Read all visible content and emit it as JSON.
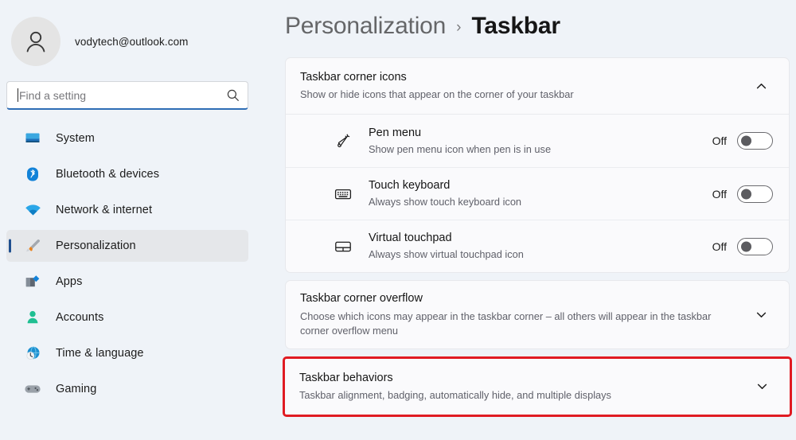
{
  "sidebar": {
    "account": {
      "email": "vodytech@outlook.com",
      "avatar_icon": "person-avatar-icon"
    },
    "search": {
      "placeholder": "Find a setting",
      "value": "",
      "icon": "search-icon"
    },
    "items": [
      {
        "label": "System",
        "icon": "monitor-icon",
        "selected": false
      },
      {
        "label": "Bluetooth & devices",
        "icon": "bluetooth-icon",
        "selected": false
      },
      {
        "label": "Network & internet",
        "icon": "wifi-icon",
        "selected": false
      },
      {
        "label": "Personalization",
        "icon": "paintbrush-icon",
        "selected": true
      },
      {
        "label": "Apps",
        "icon": "apps-icon",
        "selected": false
      },
      {
        "label": "Accounts",
        "icon": "account-icon",
        "selected": false
      },
      {
        "label": "Time & language",
        "icon": "clock-globe-icon",
        "selected": false
      },
      {
        "label": "Gaming",
        "icon": "gamepad-icon",
        "selected": false
      }
    ]
  },
  "header": {
    "breadcrumb_parent": "Personalization",
    "breadcrumb_separator": "›",
    "breadcrumb_current": "Taskbar"
  },
  "main": {
    "cards": [
      {
        "title": "Taskbar corner icons",
        "subtitle": "Show or hide icons that appear on the corner of your taskbar",
        "chevron": "chevron-up-icon",
        "expanded": true,
        "highlighted": false,
        "rows": [
          {
            "title": "Pen menu",
            "subtitle": "Show pen menu icon when pen is in use",
            "icon": "pen-icon",
            "toggle_label": "Off",
            "toggle_state": "off"
          },
          {
            "title": "Touch keyboard",
            "subtitle": "Always show touch keyboard icon",
            "icon": "touch-keyboard-icon",
            "toggle_label": "Off",
            "toggle_state": "off"
          },
          {
            "title": "Virtual touchpad",
            "subtitle": "Always show virtual touchpad icon",
            "icon": "touchpad-icon",
            "toggle_label": "Off",
            "toggle_state": "off"
          }
        ]
      },
      {
        "title": "Taskbar corner overflow",
        "subtitle": "Choose which icons may appear in the taskbar corner – all others will appear in the taskbar corner overflow menu",
        "chevron": "chevron-down-icon",
        "expanded": false,
        "highlighted": false,
        "rows": []
      },
      {
        "title": "Taskbar behaviors",
        "subtitle": "Taskbar alignment, badging, automatically hide, and multiple displays",
        "chevron": "chevron-down-icon",
        "expanded": false,
        "highlighted": true,
        "rows": []
      }
    ]
  },
  "colors": {
    "page_background": "#eff3f8",
    "card_background": "#fafafc",
    "accent": "#1f4f8f",
    "highlight_border": "#e01b22",
    "search_focus_underline": "#2f6db5"
  }
}
